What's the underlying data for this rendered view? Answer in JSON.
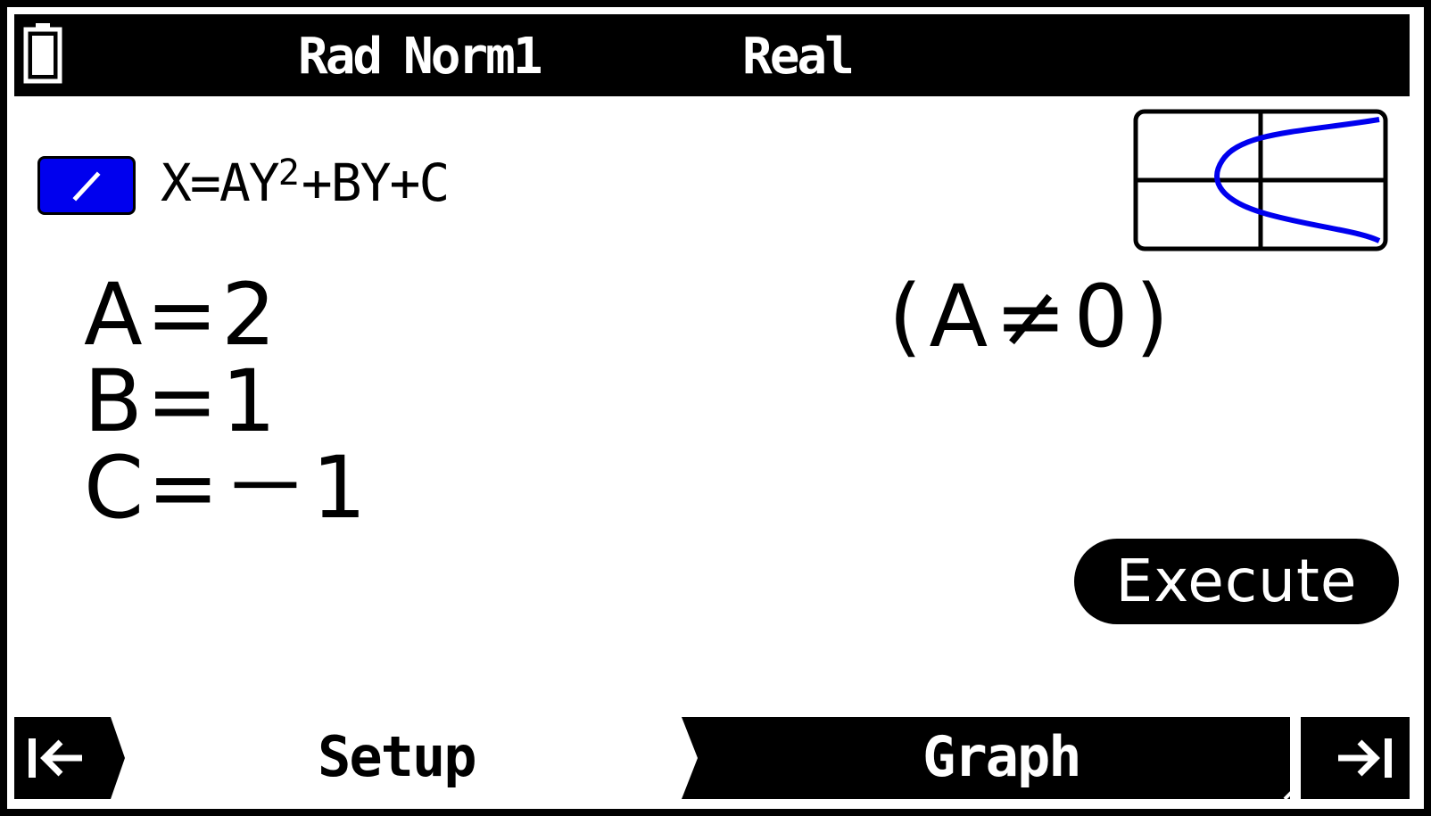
{
  "status_bar": {
    "angle": "Rad",
    "display": "Norm1",
    "complex": "Real",
    "battery_icon": "battery-icon"
  },
  "equation": {
    "icon": "graph-line-icon",
    "icon_color": "#0000ee",
    "lhs": "X=AY",
    "exponent": "2",
    "rhs": "+BY+C"
  },
  "preview": {
    "icon": "parabola-preview-icon",
    "curve_color": "#0000ee"
  },
  "coefficients": {
    "a": "A=2",
    "b": "B=1",
    "c": "C=－1"
  },
  "condition": "(A≠0)",
  "execute_label": "Execute",
  "tabs": {
    "prev_icon": "skip-left-icon",
    "setup": "Setup",
    "graph": "Graph",
    "next_icon": "skip-right-icon"
  }
}
